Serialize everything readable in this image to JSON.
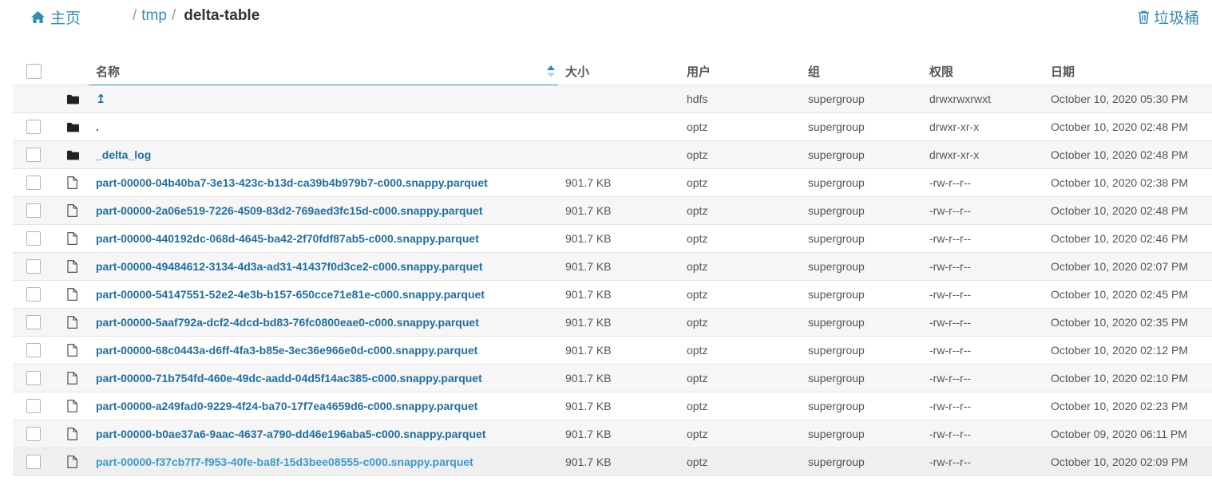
{
  "header": {
    "home_label": "主页",
    "path_sep": "/",
    "path_parent": "tmp",
    "path_current": "delta-table",
    "trash_label": "垃圾桶"
  },
  "table": {
    "columns": [
      "名称",
      "大小",
      "用户",
      "组",
      "权限",
      "日期"
    ],
    "rows": [
      {
        "type": "folder",
        "name": "↥",
        "size": "",
        "user": "hdfs",
        "group": "supergroup",
        "perm": "drwxrwxrwxt",
        "date": "October 10, 2020 05:30 PM"
      },
      {
        "type": "folder",
        "name": ".",
        "size": "",
        "user": "optz",
        "group": "supergroup",
        "perm": "drwxr-xr-x",
        "date": "October 10, 2020 02:48 PM"
      },
      {
        "type": "folder",
        "name": "_delta_log",
        "size": "",
        "user": "optz",
        "group": "supergroup",
        "perm": "drwxr-xr-x",
        "date": "October 10, 2020 02:48 PM"
      },
      {
        "type": "file",
        "name": "part-00000-04b40ba7-3e13-423c-b13d-ca39b4b979b7-c000.snappy.parquet",
        "size": "901.7 KB",
        "user": "optz",
        "group": "supergroup",
        "perm": "-rw-r--r--",
        "date": "October 10, 2020 02:38 PM"
      },
      {
        "type": "file",
        "name": "part-00000-2a06e519-7226-4509-83d2-769aed3fc15d-c000.snappy.parquet",
        "size": "901.7 KB",
        "user": "optz",
        "group": "supergroup",
        "perm": "-rw-r--r--",
        "date": "October 10, 2020 02:48 PM"
      },
      {
        "type": "file",
        "name": "part-00000-440192dc-068d-4645-ba42-2f70fdf87ab5-c000.snappy.parquet",
        "size": "901.7 KB",
        "user": "optz",
        "group": "supergroup",
        "perm": "-rw-r--r--",
        "date": "October 10, 2020 02:46 PM"
      },
      {
        "type": "file",
        "name": "part-00000-49484612-3134-4d3a-ad31-41437f0d3ce2-c000.snappy.parquet",
        "size": "901.7 KB",
        "user": "optz",
        "group": "supergroup",
        "perm": "-rw-r--r--",
        "date": "October 10, 2020 02:07 PM"
      },
      {
        "type": "file",
        "name": "part-00000-54147551-52e2-4e3b-b157-650cce71e81e-c000.snappy.parquet",
        "size": "901.7 KB",
        "user": "optz",
        "group": "supergroup",
        "perm": "-rw-r--r--",
        "date": "October 10, 2020 02:45 PM"
      },
      {
        "type": "file",
        "name": "part-00000-5aaf792a-dcf2-4dcd-bd83-76fc0800eae0-c000.snappy.parquet",
        "size": "901.7 KB",
        "user": "optz",
        "group": "supergroup",
        "perm": "-rw-r--r--",
        "date": "October 10, 2020 02:35 PM"
      },
      {
        "type": "file",
        "name": "part-00000-68c0443a-d6ff-4fa3-b85e-3ec36e966e0d-c000.snappy.parquet",
        "size": "901.7 KB",
        "user": "optz",
        "group": "supergroup",
        "perm": "-rw-r--r--",
        "date": "October 10, 2020 02:12 PM"
      },
      {
        "type": "file",
        "name": "part-00000-71b754fd-460e-49dc-aadd-04d5f14ac385-c000.snappy.parquet",
        "size": "901.7 KB",
        "user": "optz",
        "group": "supergroup",
        "perm": "-rw-r--r--",
        "date": "October 10, 2020 02:10 PM"
      },
      {
        "type": "file",
        "name": "part-00000-a249fad0-9229-4f24-ba70-17f7ea4659d6-c000.snappy.parquet",
        "size": "901.7 KB",
        "user": "optz",
        "group": "supergroup",
        "perm": "-rw-r--r--",
        "date": "October 10, 2020 02:23 PM"
      },
      {
        "type": "file",
        "name": "part-00000-b0ae37a6-9aac-4637-a790-dd46e196aba5-c000.snappy.parquet",
        "size": "901.7 KB",
        "user": "optz",
        "group": "supergroup",
        "perm": "-rw-r--r--",
        "date": "October 09, 2020 06:11 PM"
      },
      {
        "type": "file",
        "name": "part-00000-f37cb7f7-f953-40fe-ba8f-15d3bee08555-c000.snappy.parquet",
        "size": "901.7 KB",
        "user": "optz",
        "group": "supergroup",
        "perm": "-rw-r--r--",
        "date": "October 10, 2020 02:09 PM"
      }
    ]
  },
  "colors": {
    "link": "#338bb8",
    "file_link": "#1f6fa0",
    "hover_link": "#3a9ad0",
    "alt_row": "#f6f6f6"
  },
  "icons": {
    "home": "home-icon",
    "trash": "trash-icon",
    "folder": "folder-icon",
    "file": "file-icon",
    "sort": "sort-icon"
  }
}
